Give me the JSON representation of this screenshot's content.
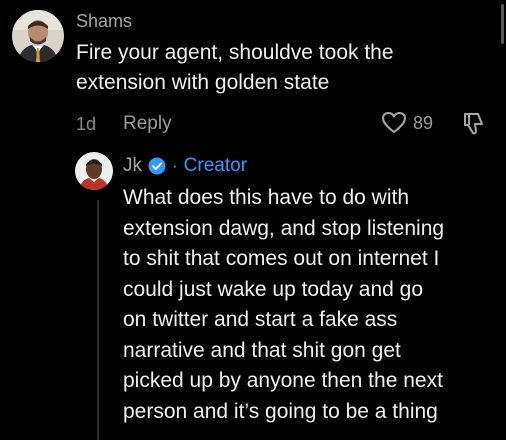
{
  "comment": {
    "username": "Shams",
    "avatar_icon": "profile-photo",
    "text_lines": [
      "Fire your agent, shouldve took the",
      "extension with golden state"
    ],
    "time": "1d",
    "reply_label": "Reply",
    "like_count": "89"
  },
  "reply": {
    "username": "Jk",
    "avatar_icon": "profile-photo",
    "verified_icon": "verified-badge-icon",
    "separator": "·",
    "creator_label": "Creator",
    "text_lines": [
      "What does this have to do with",
      "extension dawg, and stop listening",
      "to shit that comes out on internet I",
      "could just wake up today and go",
      "on twitter and start a fake ass",
      "narrative and that shit gon get",
      "picked up by anyone then the next",
      "person and it’s going to be a thing"
    ]
  },
  "colors": {
    "background": "#000000",
    "accent_blue": "#2f9bff",
    "text_primary": "#f0f0f0",
    "text_secondary": "#a6a6a6"
  }
}
